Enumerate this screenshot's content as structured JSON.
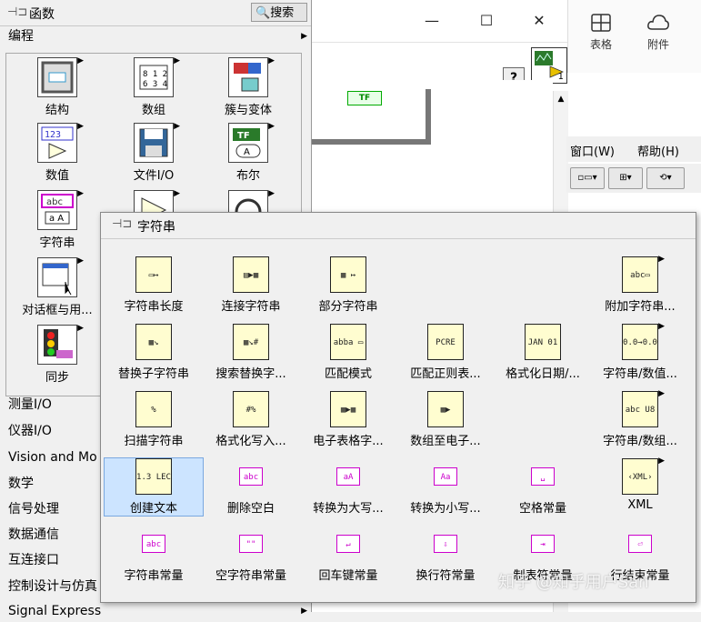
{
  "background_window": {
    "minimize": "—",
    "maximize": "☐",
    "close": "✕",
    "ribbon": [
      {
        "label": "表格"
      },
      {
        "label": "附件"
      }
    ],
    "menu": [
      {
        "label": "窗口(W)"
      },
      {
        "label": "帮助(H)"
      }
    ],
    "help_button": "?",
    "vi_icon_number": "1",
    "tf_constant": "TF"
  },
  "palette": {
    "title": "函数",
    "search_label": "搜索",
    "category_top": "编程",
    "grid_items": [
      {
        "label": "结构"
      },
      {
        "label": "数组"
      },
      {
        "label": "簇与变体"
      },
      {
        "label": "数值"
      },
      {
        "label": "文件I/O"
      },
      {
        "label": "布尔"
      },
      {
        "label": "字符串"
      },
      {
        "label": "对话框与用..."
      },
      {
        "label": "同步"
      }
    ],
    "categories": [
      {
        "label": "测量I/O"
      },
      {
        "label": "仪器I/O"
      },
      {
        "label": "Vision and Mo"
      },
      {
        "label": "数学"
      },
      {
        "label": "信号处理"
      },
      {
        "label": "数据通信"
      },
      {
        "label": "互连接口"
      },
      {
        "label": "控制设计与仿真"
      },
      {
        "label": "Signal Express"
      }
    ]
  },
  "subpalette": {
    "title": "字符串",
    "items": [
      {
        "label": "字符串长度",
        "glyph": "▭↦"
      },
      {
        "label": "连接字符串",
        "glyph": "▤▶▦"
      },
      {
        "label": "部分字符串",
        "glyph": "▦ ↦"
      },
      {
        "label": "附加字符串...",
        "glyph": "abc▭"
      },
      {
        "label": "替换子字符串",
        "glyph": "▦↘"
      },
      {
        "label": "搜索替换字...",
        "glyph": "▦↘#"
      },
      {
        "label": "匹配模式",
        "glyph": "abba ▭"
      },
      {
        "label": "匹配正则表...",
        "glyph": "PCRE"
      },
      {
        "label": "格式化日期/...",
        "glyph": "JAN 01"
      },
      {
        "label": "字符串/数值...",
        "glyph": "0.0→0.0"
      },
      {
        "label": "扫描字符串",
        "glyph": "%"
      },
      {
        "label": "格式化写入...",
        "glyph": "#%"
      },
      {
        "label": "电子表格字...",
        "glyph": "▦▶▦"
      },
      {
        "label": "数组至电子...",
        "glyph": "▦▶"
      },
      {
        "label": "字符串/数组...",
        "glyph": "abc U8"
      },
      {
        "label": "创建文本",
        "glyph": "1.3 LEC"
      },
      {
        "label": "删除空白",
        "glyph": "abc"
      },
      {
        "label": "转换为大写...",
        "glyph": "aA"
      },
      {
        "label": "转换为小写...",
        "glyph": "Aa"
      },
      {
        "label": "空格常量",
        "glyph": "␣"
      },
      {
        "label": "XML",
        "glyph": "‹XML›"
      },
      {
        "label": "字符串常量",
        "glyph": "abc"
      },
      {
        "label": "空字符串常量",
        "glyph": "\"\""
      },
      {
        "label": "回车键常量",
        "glyph": "↵"
      },
      {
        "label": "换行符常量",
        "glyph": "⇩"
      },
      {
        "label": "制表符常量",
        "glyph": "⇥"
      },
      {
        "label": "行结束常量",
        "glyph": "⏎"
      }
    ]
  },
  "watermark": "知乎 @知乎用户San",
  "colors": {
    "palette_bg": "#f0f0f0",
    "icon_bg": "#fffdd0",
    "constant_magenta": "#cc00cc",
    "selection": "#cce4ff"
  }
}
